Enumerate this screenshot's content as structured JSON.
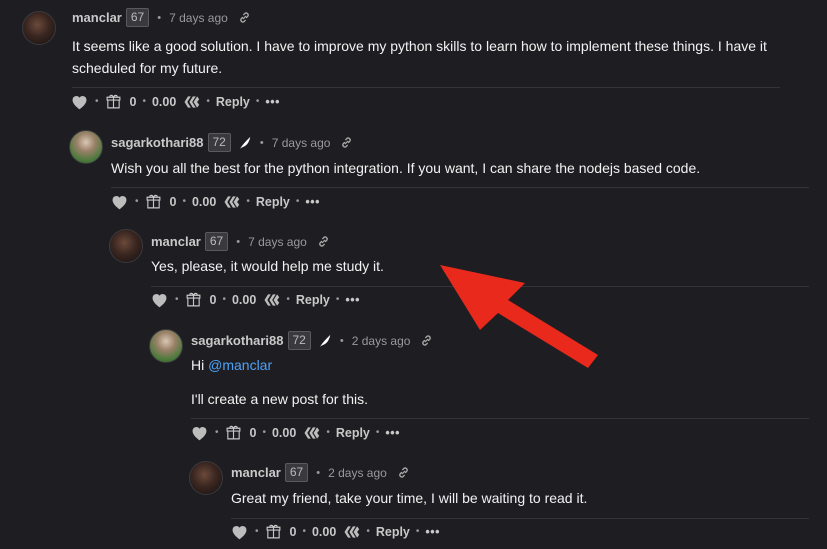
{
  "comments": [
    {
      "author": "manclar",
      "reputation": "67",
      "time": "7 days ago",
      "body": [
        "It seems like a good solution. I have to improve my python skills to learn how to implement these things. I have it scheduled for my future."
      ],
      "votes": "0",
      "payout": "0.00",
      "reply_label": "Reply",
      "more_label": "•••"
    },
    {
      "author": "sagarkothari88",
      "reputation": "72",
      "time": "7 days ago",
      "body": [
        "Wish you all the best for the python integration. If you want, I can share the nodejs based code."
      ],
      "votes": "0",
      "payout": "0.00",
      "reply_label": "Reply",
      "more_label": "•••"
    },
    {
      "author": "manclar",
      "reputation": "67",
      "time": "7 days ago",
      "body": [
        "Yes, please, it would help me study it."
      ],
      "votes": "0",
      "payout": "0.00",
      "reply_label": "Reply",
      "more_label": "•••"
    },
    {
      "author": "sagarkothari88",
      "reputation": "72",
      "time": "2 days ago",
      "body_greeting": "Hi",
      "body_mention": "@manclar",
      "body": [
        "I'll create a new post for this."
      ],
      "votes": "0",
      "payout": "0.00",
      "reply_label": "Reply",
      "more_label": "•••"
    },
    {
      "author": "manclar",
      "reputation": "67",
      "time": "2 days ago",
      "body": [
        "Great my friend, take your time, I will be waiting to read it."
      ],
      "votes": "0",
      "payout": "0.00",
      "reply_label": "Reply",
      "more_label": "•••"
    }
  ],
  "colors": {
    "background": "#1e1e22",
    "mention": "#4ea1f5",
    "annotation_arrow": "#e8291c"
  },
  "icons": [
    "heart-icon",
    "gift-icon",
    "hive-icon",
    "link-icon",
    "feather-icon"
  ]
}
